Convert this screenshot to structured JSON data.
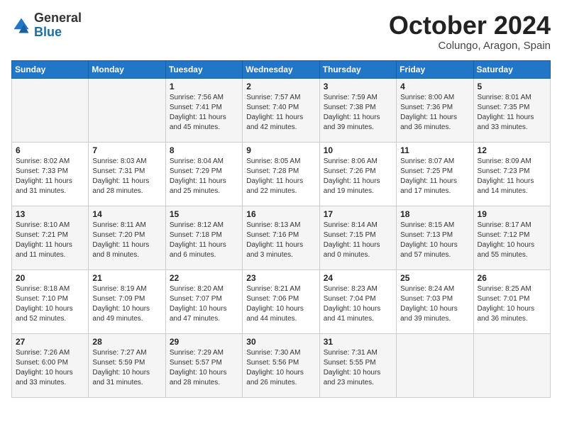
{
  "header": {
    "logo_general": "General",
    "logo_blue": "Blue",
    "month": "October 2024",
    "location": "Colungo, Aragon, Spain"
  },
  "days_of_week": [
    "Sunday",
    "Monday",
    "Tuesday",
    "Wednesday",
    "Thursday",
    "Friday",
    "Saturday"
  ],
  "weeks": [
    [
      {
        "day": "",
        "content": ""
      },
      {
        "day": "",
        "content": ""
      },
      {
        "day": "1",
        "content": "Sunrise: 7:56 AM\nSunset: 7:41 PM\nDaylight: 11 hours and 45 minutes."
      },
      {
        "day": "2",
        "content": "Sunrise: 7:57 AM\nSunset: 7:40 PM\nDaylight: 11 hours and 42 minutes."
      },
      {
        "day": "3",
        "content": "Sunrise: 7:59 AM\nSunset: 7:38 PM\nDaylight: 11 hours and 39 minutes."
      },
      {
        "day": "4",
        "content": "Sunrise: 8:00 AM\nSunset: 7:36 PM\nDaylight: 11 hours and 36 minutes."
      },
      {
        "day": "5",
        "content": "Sunrise: 8:01 AM\nSunset: 7:35 PM\nDaylight: 11 hours and 33 minutes."
      }
    ],
    [
      {
        "day": "6",
        "content": "Sunrise: 8:02 AM\nSunset: 7:33 PM\nDaylight: 11 hours and 31 minutes."
      },
      {
        "day": "7",
        "content": "Sunrise: 8:03 AM\nSunset: 7:31 PM\nDaylight: 11 hours and 28 minutes."
      },
      {
        "day": "8",
        "content": "Sunrise: 8:04 AM\nSunset: 7:29 PM\nDaylight: 11 hours and 25 minutes."
      },
      {
        "day": "9",
        "content": "Sunrise: 8:05 AM\nSunset: 7:28 PM\nDaylight: 11 hours and 22 minutes."
      },
      {
        "day": "10",
        "content": "Sunrise: 8:06 AM\nSunset: 7:26 PM\nDaylight: 11 hours and 19 minutes."
      },
      {
        "day": "11",
        "content": "Sunrise: 8:07 AM\nSunset: 7:25 PM\nDaylight: 11 hours and 17 minutes."
      },
      {
        "day": "12",
        "content": "Sunrise: 8:09 AM\nSunset: 7:23 PM\nDaylight: 11 hours and 14 minutes."
      }
    ],
    [
      {
        "day": "13",
        "content": "Sunrise: 8:10 AM\nSunset: 7:21 PM\nDaylight: 11 hours and 11 minutes."
      },
      {
        "day": "14",
        "content": "Sunrise: 8:11 AM\nSunset: 7:20 PM\nDaylight: 11 hours and 8 minutes."
      },
      {
        "day": "15",
        "content": "Sunrise: 8:12 AM\nSunset: 7:18 PM\nDaylight: 11 hours and 6 minutes."
      },
      {
        "day": "16",
        "content": "Sunrise: 8:13 AM\nSunset: 7:16 PM\nDaylight: 11 hours and 3 minutes."
      },
      {
        "day": "17",
        "content": "Sunrise: 8:14 AM\nSunset: 7:15 PM\nDaylight: 11 hours and 0 minutes."
      },
      {
        "day": "18",
        "content": "Sunrise: 8:15 AM\nSunset: 7:13 PM\nDaylight: 10 hours and 57 minutes."
      },
      {
        "day": "19",
        "content": "Sunrise: 8:17 AM\nSunset: 7:12 PM\nDaylight: 10 hours and 55 minutes."
      }
    ],
    [
      {
        "day": "20",
        "content": "Sunrise: 8:18 AM\nSunset: 7:10 PM\nDaylight: 10 hours and 52 minutes."
      },
      {
        "day": "21",
        "content": "Sunrise: 8:19 AM\nSunset: 7:09 PM\nDaylight: 10 hours and 49 minutes."
      },
      {
        "day": "22",
        "content": "Sunrise: 8:20 AM\nSunset: 7:07 PM\nDaylight: 10 hours and 47 minutes."
      },
      {
        "day": "23",
        "content": "Sunrise: 8:21 AM\nSunset: 7:06 PM\nDaylight: 10 hours and 44 minutes."
      },
      {
        "day": "24",
        "content": "Sunrise: 8:23 AM\nSunset: 7:04 PM\nDaylight: 10 hours and 41 minutes."
      },
      {
        "day": "25",
        "content": "Sunrise: 8:24 AM\nSunset: 7:03 PM\nDaylight: 10 hours and 39 minutes."
      },
      {
        "day": "26",
        "content": "Sunrise: 8:25 AM\nSunset: 7:01 PM\nDaylight: 10 hours and 36 minutes."
      }
    ],
    [
      {
        "day": "27",
        "content": "Sunrise: 7:26 AM\nSunset: 6:00 PM\nDaylight: 10 hours and 33 minutes."
      },
      {
        "day": "28",
        "content": "Sunrise: 7:27 AM\nSunset: 5:59 PM\nDaylight: 10 hours and 31 minutes."
      },
      {
        "day": "29",
        "content": "Sunrise: 7:29 AM\nSunset: 5:57 PM\nDaylight: 10 hours and 28 minutes."
      },
      {
        "day": "30",
        "content": "Sunrise: 7:30 AM\nSunset: 5:56 PM\nDaylight: 10 hours and 26 minutes."
      },
      {
        "day": "31",
        "content": "Sunrise: 7:31 AM\nSunset: 5:55 PM\nDaylight: 10 hours and 23 minutes."
      },
      {
        "day": "",
        "content": ""
      },
      {
        "day": "",
        "content": ""
      }
    ]
  ]
}
